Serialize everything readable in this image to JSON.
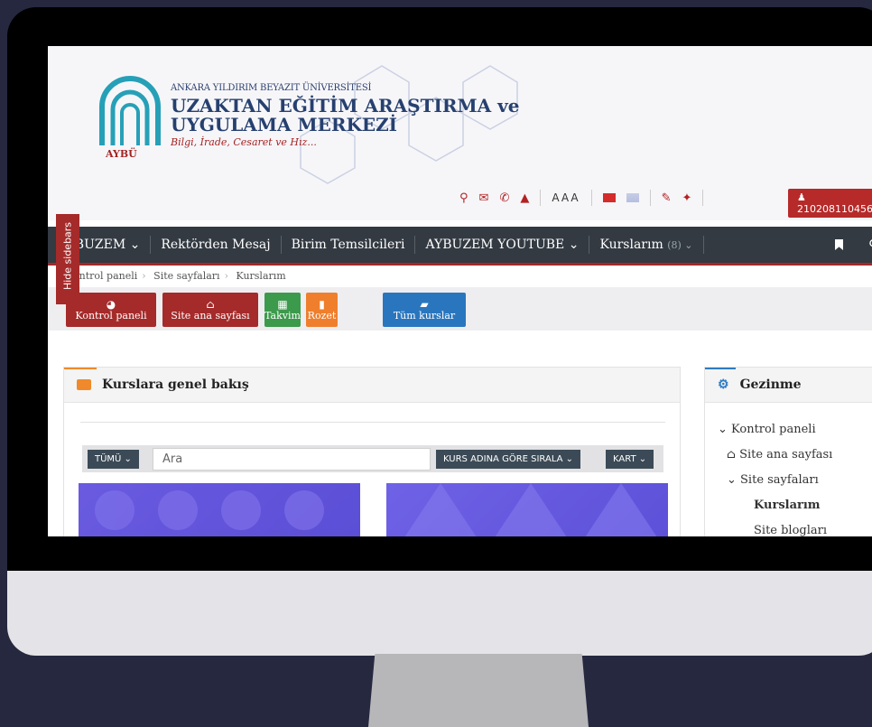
{
  "header": {
    "university": "ANKARA YILDIRIM BEYAZIT ÜNİVERSİTESİ",
    "title_line1": "UZAKTAN EĞİTİM ARAŞTIRMA ve",
    "title_line2": "UYGULAMA MERKEZİ",
    "motto": "Bilgi, İrade, Cesaret ve Hız...",
    "logo_text": "AYBÜ",
    "font_size_label": "AAA",
    "user_id": "210208110456"
  },
  "nav": {
    "items": [
      "AYBUZEM ⌄",
      "Rektörden Mesaj",
      "Birim Temsilcileri",
      "AYBUZEM YOUTUBE ⌄",
      "Kurslarım"
    ],
    "courses_count": "(8) ⌄"
  },
  "hide_sidebars": "Hide sidebars",
  "breadcrumb": [
    "ontrol paneli",
    "Site sayfaları",
    "Kurslarım"
  ],
  "quick": [
    {
      "label": "Kontrol paneli",
      "icon": "dashboard-icon",
      "color": "#a52a2a"
    },
    {
      "label": "Site ana sayfası",
      "icon": "home-icon",
      "color": "#a52a2a"
    },
    {
      "label": "Takvim",
      "icon": "calendar-icon",
      "color": "#3c9a4c"
    },
    {
      "label": "Rozet",
      "icon": "bookmark-icon",
      "color": "#ef7f2c"
    },
    {
      "label": "Tüm kurslar",
      "icon": "book-icon",
      "color": "#2a76be"
    }
  ],
  "overview": {
    "title": "Kurslara genel bakış",
    "filter": "TÜMÜ ⌄",
    "search_placeholder": "Ara",
    "sort": "KURS ADINA GÖRE SIRALA ⌄",
    "view": "KART ⌄"
  },
  "sidebar": {
    "title": "Gezinme",
    "tree": [
      "⌄ Kontrol paneli",
      "Site ana sayfası",
      "⌄ Site sayfaları",
      "Kurslarım",
      "Site blogları"
    ]
  }
}
